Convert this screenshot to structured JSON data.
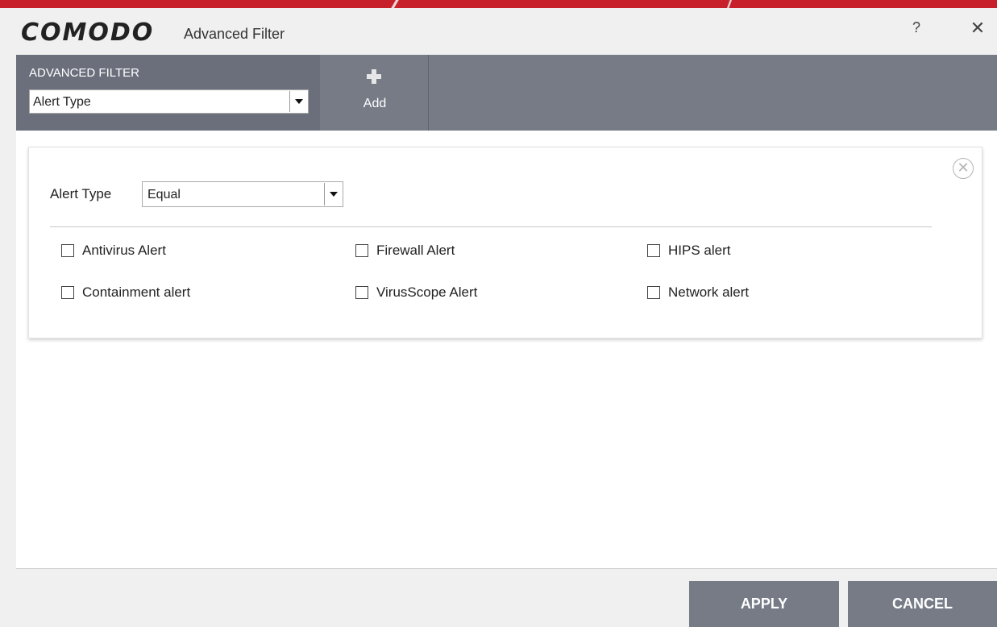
{
  "window": {
    "logo": "COMODO",
    "title": "Advanced Filter",
    "help_glyph": "?",
    "close_glyph": "✕"
  },
  "toolbar": {
    "filter_heading": "ADVANCED FILTER",
    "filter_selected": "Alert Type",
    "add_label": "Add"
  },
  "condition": {
    "label": "Alert Type",
    "operator": "Equal",
    "remove_glyph": "✕",
    "options": [
      {
        "label": "Antivirus Alert",
        "checked": false
      },
      {
        "label": "Firewall Alert",
        "checked": false
      },
      {
        "label": "HIPS alert",
        "checked": false
      },
      {
        "label": "Containment alert",
        "checked": false
      },
      {
        "label": "VirusScope Alert",
        "checked": false
      },
      {
        "label": "Network alert",
        "checked": false
      }
    ]
  },
  "footer": {
    "apply_label": "APPLY",
    "cancel_label": "CANCEL"
  },
  "colors": {
    "brand_red": "#c8202a",
    "toolbar_gray": "#767b86",
    "toolbar_dark": "#6a6f7b"
  }
}
